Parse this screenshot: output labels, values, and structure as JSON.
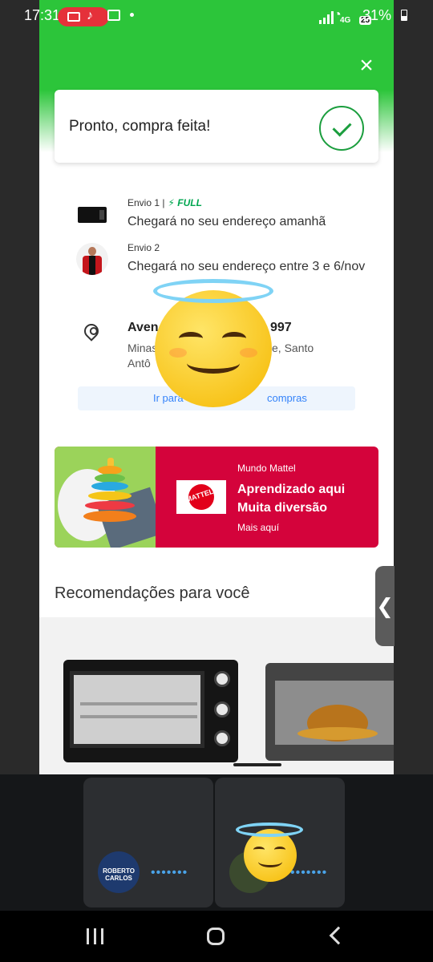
{
  "status_bar": {
    "time": "17:31",
    "battery": "31%",
    "network": "4G",
    "badge": "25"
  },
  "purchase": {
    "done_title": "Pronto, compra feita!"
  },
  "shipments": [
    {
      "label": "Envio 1 |",
      "full_tag": "⚡ FULL",
      "text": "Chegará no seu endereço amanhã"
    },
    {
      "label": "Envio 2",
      "full_tag": "",
      "text": "Chegará no seu endereço entre 3 e 6/nov"
    }
  ],
  "address": {
    "title_start": "Aven",
    "title_end": "997",
    "line1_start": "Minas",
    "line1_end": "e, Santo",
    "line2_start": "Antô"
  },
  "go_button": {
    "left": "Ir para",
    "right": "compras"
  },
  "banner": {
    "kicker": "Mundo Mattel",
    "title": "Aprendizado aqui Muita diversão",
    "link": "Mais aquí",
    "logo_text": "MATTEL"
  },
  "recommendations": {
    "title": "Recomendações para você"
  },
  "call": {
    "avatar1_text": "ROBERTO CARLOS"
  },
  "icons": {
    "close": "×",
    "side_tab": "❮",
    "dots": "•••••••"
  },
  "colors": {
    "brand_green": "#2cc53a",
    "full_green": "#00a650",
    "link_blue": "#3483fa",
    "mattel_red": "#d4033b"
  }
}
